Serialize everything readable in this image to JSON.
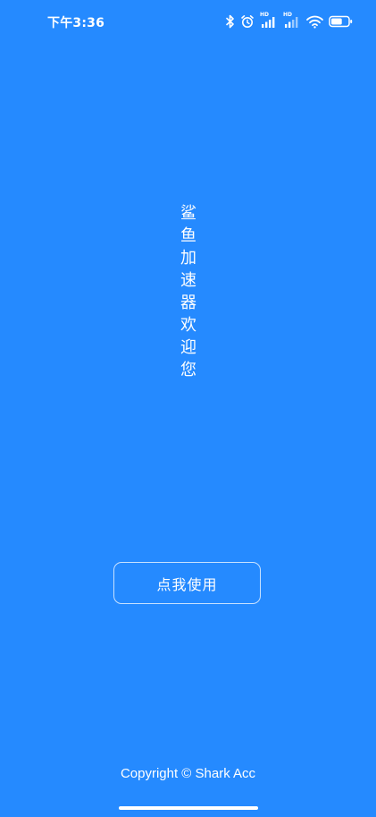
{
  "status_bar": {
    "time": "下午3:36",
    "icons": [
      "bluetooth-icon",
      "alarm-icon",
      "signal-hd-icon",
      "signal-hd-icon",
      "wifi-icon",
      "battery-icon"
    ],
    "hd_label": "HD",
    "battery_level": 0.65
  },
  "welcome": {
    "chars": [
      "鲨",
      "鱼",
      "加",
      "速",
      "器",
      "欢",
      "迎",
      "您"
    ]
  },
  "button": {
    "label": "点我使用"
  },
  "footer": {
    "copyright": "Copyright © Shark Acc"
  },
  "colors": {
    "background": "#258aff",
    "foreground": "#ffffff"
  }
}
